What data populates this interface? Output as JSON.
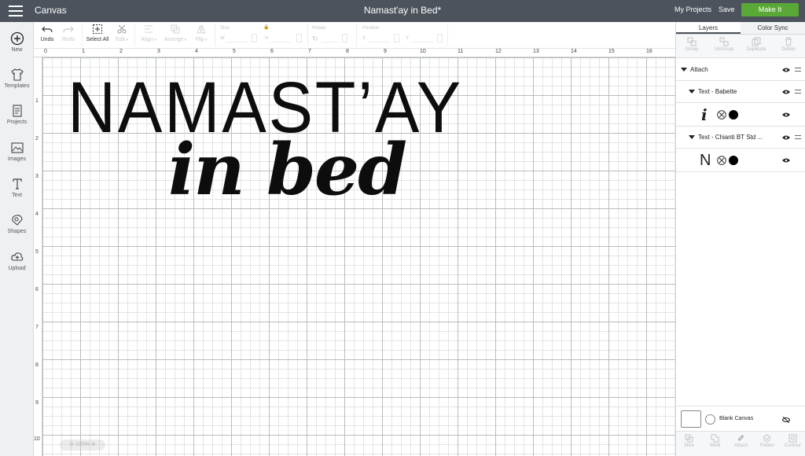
{
  "topbar": {
    "app_title": "Canvas",
    "project_title": "Namast'ay in Bed*",
    "my_projects": "My Projects",
    "save": "Save",
    "make_it": "Make It",
    "make_it_color": "#5aa836",
    "bar_color": "#4c535c"
  },
  "leftbar": {
    "items": [
      {
        "label": "New",
        "icon": "plus-circle-icon"
      },
      {
        "label": "Templates",
        "icon": "shirt-icon"
      },
      {
        "label": "Projects",
        "icon": "projects-icon"
      },
      {
        "label": "Images",
        "icon": "image-icon"
      },
      {
        "label": "Text",
        "icon": "text-icon"
      },
      {
        "label": "Shapes",
        "icon": "shapes-icon"
      },
      {
        "label": "Upload",
        "icon": "cloud-upload-icon"
      }
    ]
  },
  "toolbar": {
    "undo": "Undo",
    "redo": "Redo",
    "select_all": "Select All",
    "edit": "Edit",
    "align": "Align",
    "arrange": "Arrange",
    "flip": "Flip",
    "size": "Size",
    "w": "W",
    "h": "H",
    "rotate": "Rotate",
    "position": "Position",
    "x": "X",
    "y": "Y"
  },
  "ruler": {
    "top": [
      "0",
      "1",
      "2",
      "3",
      "4",
      "5",
      "6",
      "7",
      "8",
      "9",
      "10",
      "11",
      "12",
      "13",
      "14",
      "15",
      "16"
    ],
    "left": [
      "1",
      "2",
      "3",
      "4",
      "5",
      "6",
      "7",
      "8",
      "9",
      "10"
    ]
  },
  "design": {
    "line1": "NAMAST’AY",
    "line2": "in bed"
  },
  "zoom": "100%",
  "panel": {
    "tabs": [
      "Layers",
      "Color Sync"
    ],
    "tools": [
      "Group",
      "UnGroup",
      "Duplicate",
      "Delete"
    ],
    "attach": "Attach",
    "layer1": "Text - Babette",
    "layer1_glyph": "i",
    "layer2": "Text - Chianti BT Std ...",
    "layer2_glyph": "N",
    "blank_canvas": "Blank Canvas",
    "bottom_tools": [
      "Slice",
      "Weld",
      "Attach",
      "Flatten",
      "Contour"
    ]
  }
}
